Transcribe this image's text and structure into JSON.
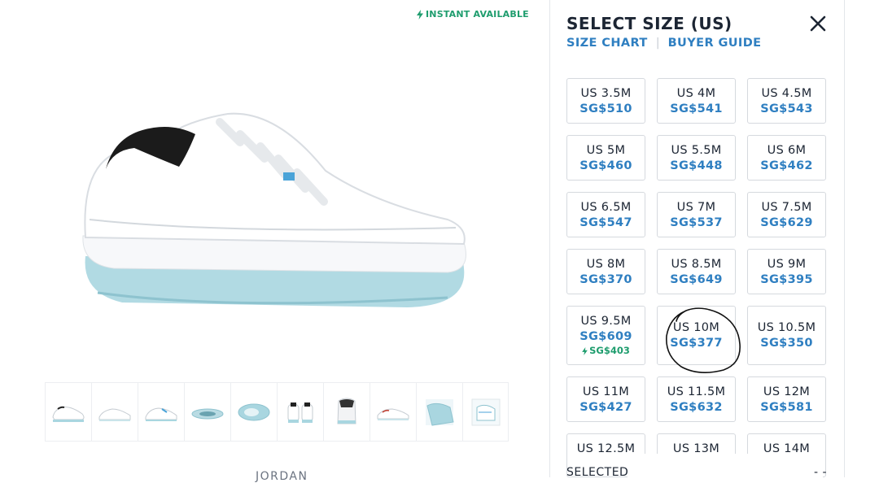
{
  "badge": {
    "instant_label": "INSTANT AVAILABLE"
  },
  "product": {
    "brand": "JORDAN",
    "thumbnail_count": 10
  },
  "drawer": {
    "title": "SELECT SIZE (US)",
    "size_chart_label": "SIZE CHART",
    "separator": "|",
    "buyer_guide_label": "BUYER GUIDE",
    "selected_label": "SELECTED",
    "selected_value": "- -"
  },
  "sizes": [
    {
      "size": "US 3.5M",
      "price": "SG$510"
    },
    {
      "size": "US 4M",
      "price": "SG$541"
    },
    {
      "size": "US 4.5M",
      "price": "SG$543"
    },
    {
      "size": "US 5M",
      "price": "SG$460"
    },
    {
      "size": "US 5.5M",
      "price": "SG$448"
    },
    {
      "size": "US 6M",
      "price": "SG$462"
    },
    {
      "size": "US 6.5M",
      "price": "SG$547"
    },
    {
      "size": "US 7M",
      "price": "SG$537"
    },
    {
      "size": "US 7.5M",
      "price": "SG$629"
    },
    {
      "size": "US 8M",
      "price": "SG$370"
    },
    {
      "size": "US 8.5M",
      "price": "SG$649"
    },
    {
      "size": "US 9M",
      "price": "SG$395"
    },
    {
      "size": "US 9.5M",
      "price": "SG$609",
      "instant_price": "SG$403"
    },
    {
      "size": "US 10M",
      "price": "SG$377"
    },
    {
      "size": "US 10.5M",
      "price": "SG$350"
    },
    {
      "size": "US 11M",
      "price": "SG$427"
    },
    {
      "size": "US 11.5M",
      "price": "SG$632"
    },
    {
      "size": "US 12M",
      "price": "SG$581"
    },
    {
      "size": "US 12.5M",
      "price": ""
    },
    {
      "size": "US 13M",
      "price": ""
    },
    {
      "size": "US 14M",
      "price": ""
    }
  ],
  "colors": {
    "accent_blue": "#2f7fc1",
    "instant_green": "#1f9d6e",
    "sole_ice_blue": "#a9d6e0"
  },
  "icons": {
    "close": "close-icon",
    "bolt": "lightning-bolt-icon"
  }
}
